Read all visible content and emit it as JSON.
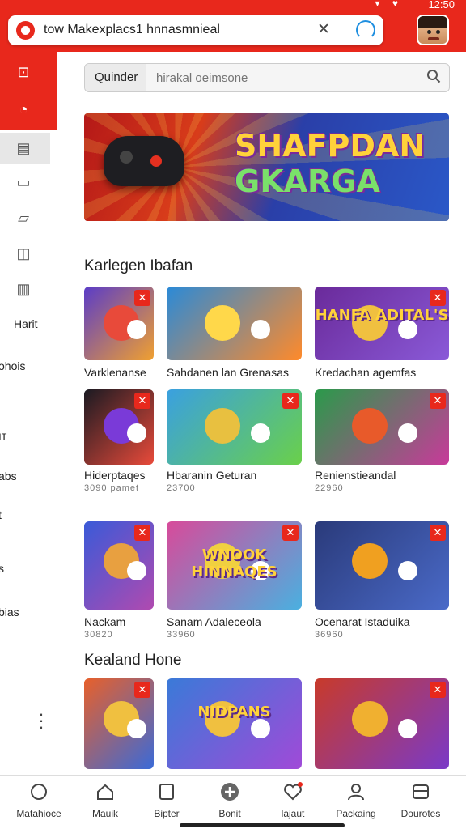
{
  "status": {
    "time": "12:50"
  },
  "browser": {
    "url": "tow Makexplacs1 hnnasmnieal"
  },
  "search": {
    "chip": "Quinder",
    "placeholder": "hirakal oeimsone"
  },
  "banner": {
    "title_line1": "SHAFPDAN",
    "title_line2": "GKARGA"
  },
  "sidebar": {
    "labels": [
      "Harit",
      "ohois",
      "ıт",
      "abs",
      "t",
      "s",
      "bias"
    ]
  },
  "sections": [
    {
      "title": "Karlegen Ibafan"
    },
    {
      "title": "Kealand Hone"
    }
  ],
  "games": [
    {
      "name": "Varklenanse",
      "meta": "",
      "art": "",
      "colors": [
        "#5a3cc8",
        "#f0a030",
        "#e84a3a"
      ]
    },
    {
      "name": "Sahdanen lan Grenasas",
      "meta": "",
      "art": "",
      "colors": [
        "#2a8ad8",
        "#ff8a2a",
        "#ffd84a"
      ]
    },
    {
      "name": "Kredachan agemfas",
      "meta": "",
      "art": "HANFA ADITAL'S",
      "colors": [
        "#6a2a9a",
        "#8a5ad8",
        "#f0c040"
      ]
    },
    {
      "name": "Hiderptaqes",
      "meta": "3090 pamet",
      "art": "",
      "colors": [
        "#1a1a22",
        "#e84a3a",
        "#7a3ad8"
      ]
    },
    {
      "name": "Hbaranin Geturan",
      "meta": "23700",
      "art": "",
      "colors": [
        "#3aa0e0",
        "#6ad04a",
        "#e8c040"
      ]
    },
    {
      "name": "Renienstieandal",
      "meta": "22960",
      "art": "",
      "colors": [
        "#2a9a4a",
        "#c83a9a",
        "#e85a2a"
      ]
    },
    {
      "name": "Nackam",
      "meta": "30820",
      "art": "",
      "colors": [
        "#3a5ad8",
        "#b04ab0",
        "#e8a040"
      ]
    },
    {
      "name": "Sanam Adaleceola",
      "meta": "33960",
      "art": "WNOOK HINNAQES",
      "colors": [
        "#d84a9a",
        "#4ab0e0",
        "#f0d040"
      ]
    },
    {
      "name": "Ocenarat Istaduika",
      "meta": "36960",
      "art": "",
      "colors": [
        "#2a3a7a",
        "#4a6ac8",
        "#f0a020"
      ]
    },
    {
      "name": "",
      "meta": "",
      "art": "",
      "colors": [
        "#e8602a",
        "#3a6ad8",
        "#f0c040"
      ]
    },
    {
      "name": "",
      "meta": "",
      "art": "NIDPANS",
      "colors": [
        "#3a7ad8",
        "#a04ad8",
        "#f0c040"
      ]
    },
    {
      "name": "",
      "meta": "",
      "art": "",
      "colors": [
        "#c83a2a",
        "#7a3ac8",
        "#f0b030"
      ]
    }
  ],
  "nav": [
    {
      "label": "Matahioce",
      "icon": "mic-icon"
    },
    {
      "label": "Mauik",
      "icon": "home-icon"
    },
    {
      "label": "Bipter",
      "icon": "tablet-icon"
    },
    {
      "label": "Bonit",
      "icon": "plus-circle-icon"
    },
    {
      "label": "lajaut",
      "icon": "heart-icon"
    },
    {
      "label": "Packaing",
      "icon": "person-icon"
    },
    {
      "label": "Dourotes",
      "icon": "box-icon"
    }
  ]
}
